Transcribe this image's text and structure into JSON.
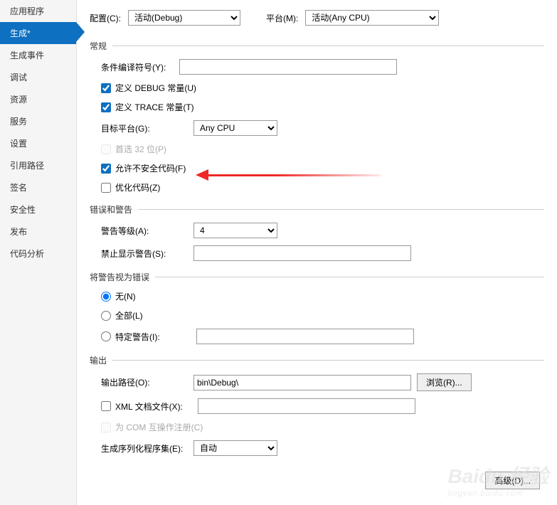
{
  "sidebar": {
    "items": [
      {
        "label": "应用程序"
      },
      {
        "label": "生成*",
        "active": true
      },
      {
        "label": "生成事件"
      },
      {
        "label": "调试"
      },
      {
        "label": "资源"
      },
      {
        "label": "服务"
      },
      {
        "label": "设置"
      },
      {
        "label": "引用路径"
      },
      {
        "label": "签名"
      },
      {
        "label": "安全性"
      },
      {
        "label": "发布"
      },
      {
        "label": "代码分析"
      }
    ]
  },
  "top": {
    "config_label": "配置(C):",
    "config_value": "活动(Debug)",
    "platform_label": "平台(M):",
    "platform_value": "活动(Any CPU)"
  },
  "general": {
    "title": "常规",
    "cond_symbols_label": "条件编译符号(Y):",
    "cond_symbols_value": "",
    "debug_const": "定义 DEBUG 常量(U)",
    "trace_const": "定义 TRACE 常量(T)",
    "target_label": "目标平台(G):",
    "target_value": "Any CPU",
    "prefer32": "首选 32 位(P)",
    "unsafe": "允许不安全代码(F)",
    "optimize": "优化代码(Z)"
  },
  "warnings": {
    "title": "错误和警告",
    "level_label": "警告等级(A):",
    "level_value": "4",
    "suppress_label": "禁止显示警告(S):",
    "suppress_value": ""
  },
  "treat": {
    "title": "将警告视为错误",
    "none": "无(N)",
    "all": "全部(L)",
    "specific": "特定警告(I):",
    "specific_value": ""
  },
  "output": {
    "title": "输出",
    "path_label": "输出路径(O):",
    "path_value": "bin\\Debug\\",
    "browse": "浏览(R)...",
    "xml_doc": "XML 文档文件(X):",
    "xml_value": "",
    "com": "为 COM 互操作注册(C)",
    "serial_label": "生成序列化程序集(E):",
    "serial_value": "自动",
    "advanced": "高级(D)..."
  },
  "watermark": {
    "brand": "Baidu 经验",
    "url": "jingyan.baidu.com"
  }
}
